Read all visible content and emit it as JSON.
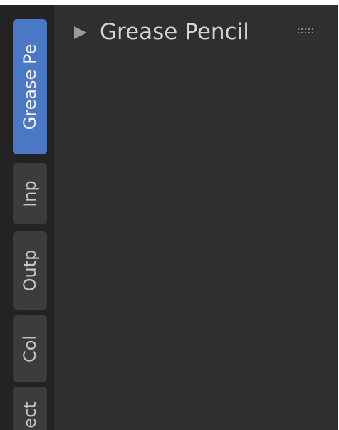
{
  "sidebar": {
    "tabs": [
      {
        "label": "Grease Pe",
        "active": true
      },
      {
        "label": "Inp",
        "active": false
      },
      {
        "label": "Outp",
        "active": false
      },
      {
        "label": "Col",
        "active": false
      },
      {
        "label": "ect",
        "active": false
      }
    ]
  },
  "panel": {
    "title": "Grease Pencil",
    "expanded": false,
    "disclosure_icon": "triangle-right-icon",
    "handle_icon": "drag-handle-icon"
  },
  "colors": {
    "active_tab": "#4a78c4",
    "inactive_tab": "#3c3c3c",
    "panel_bg": "#2f2f2f",
    "tab_strip_bg": "#232323",
    "text": "#d4d4d4"
  }
}
